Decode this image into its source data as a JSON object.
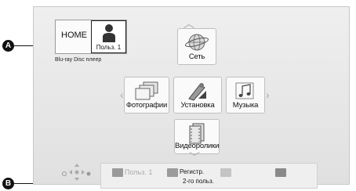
{
  "callouts": {
    "a": "A",
    "b": "B"
  },
  "home": {
    "label": "HOME",
    "user_label": "Польз. 1",
    "player_label": "Blu-ray Disc плеер"
  },
  "tiles": {
    "network": "Сеть",
    "photos": "Фотографии",
    "setup": "Установка",
    "music": "Музыка",
    "videos": "Видеоролики"
  },
  "colorbar": {
    "user1": "Польз. 1",
    "register_line1": "Регистр.",
    "register_line2": "2-го польз.",
    "colors": {
      "red": "#9a9a9a",
      "green": "#9a9a9a",
      "yellow": "#c4c4c4",
      "blue": "#8a8a8a"
    }
  },
  "icons": {
    "user": "user-icon",
    "network": "globe-icon",
    "photos": "photo-frames-icon",
    "setup": "setup-tools-icon",
    "music": "music-note-icon",
    "videos": "film-icon",
    "nav": "dpad-icon"
  }
}
